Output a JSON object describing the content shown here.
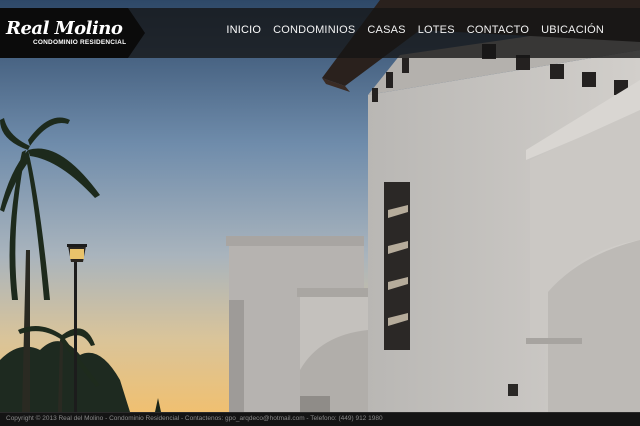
{
  "brand": {
    "name": "Real del Molino",
    "logo_main": "Real Molino",
    "logo_sub": "CONDOMINIO RESIDENCIAL"
  },
  "nav": {
    "items": [
      {
        "label": "INICIO",
        "active": true
      },
      {
        "label": "CONDOMINIOS",
        "active": false
      },
      {
        "label": "CASAS",
        "active": false
      },
      {
        "label": "LOTES",
        "active": false
      },
      {
        "label": "CONTACTO",
        "active": false
      },
      {
        "label": "UBICACIÓN",
        "active": false
      }
    ]
  },
  "footer": {
    "text": "Copyright © 2013 Real del Molino - Condominio Residencial - Contactenos: gpo_arqdeco@hotmail.com - Telefono: (449) 912 1980"
  },
  "colors": {
    "navbar_bg": "#141414",
    "logo_bg": "#0a0a0a",
    "sky_top": "#2f4a6b",
    "sky_bottom": "#e7c07a",
    "wall": "#c9c6c2"
  }
}
